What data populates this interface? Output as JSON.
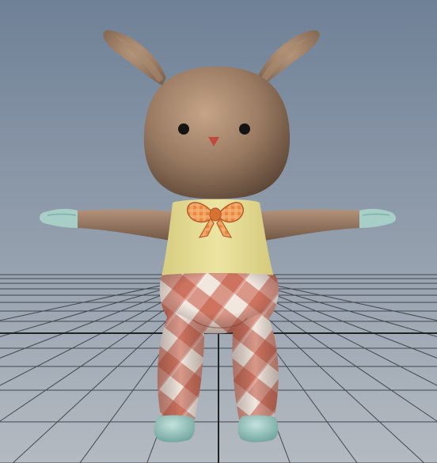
{
  "viewport": {
    "background_top": "#6f8197",
    "background_bottom": "#b4bac1",
    "grid_color": "#30363b",
    "grid_axis_color": "#1f2326"
  },
  "character": {
    "icon": "bunny-character-model",
    "colors": {
      "fur": "#9a7b62",
      "fur_light": "#c5a487",
      "fur_dark": "#5e4838",
      "ear_inner": "#b7987c",
      "eyes": "#161412",
      "nose": "#c24a3c",
      "shirt": "#ece5a2",
      "shirt_shade": "#d7cc80",
      "bow": "#e8873e",
      "bow_dark": "#b8592a",
      "pants_base": "#f1e7df",
      "pants_check": "#c5563f",
      "hands": "#a7cfc8",
      "shoes": "#9fcac4"
    }
  }
}
